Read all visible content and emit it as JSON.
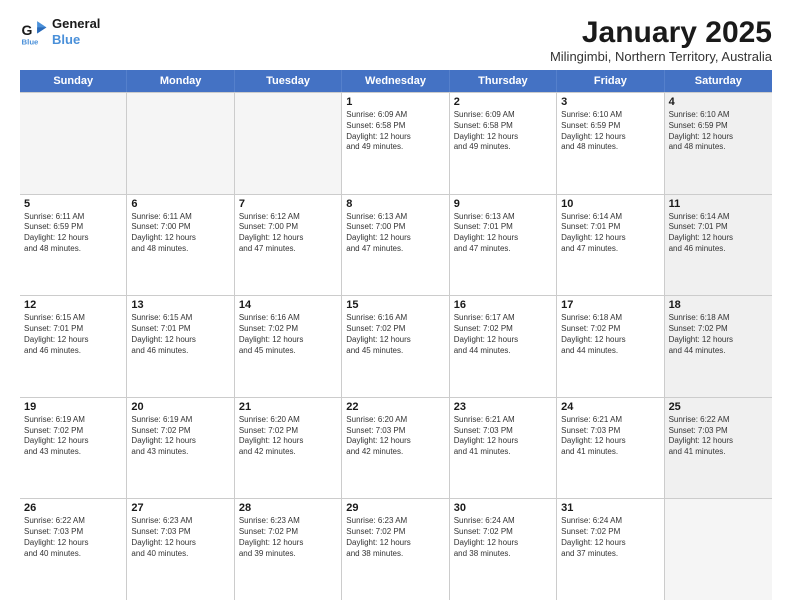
{
  "logo": {
    "line1": "General",
    "line2": "Blue"
  },
  "title": "January 2025",
  "location": "Milingimbi, Northern Territory, Australia",
  "weekdays": [
    "Sunday",
    "Monday",
    "Tuesday",
    "Wednesday",
    "Thursday",
    "Friday",
    "Saturday"
  ],
  "weeks": [
    [
      {
        "day": "",
        "text": "",
        "empty": true
      },
      {
        "day": "",
        "text": "",
        "empty": true
      },
      {
        "day": "",
        "text": "",
        "empty": true
      },
      {
        "day": "1",
        "text": "Sunrise: 6:09 AM\nSunset: 6:58 PM\nDaylight: 12 hours\nand 49 minutes."
      },
      {
        "day": "2",
        "text": "Sunrise: 6:09 AM\nSunset: 6:58 PM\nDaylight: 12 hours\nand 49 minutes."
      },
      {
        "day": "3",
        "text": "Sunrise: 6:10 AM\nSunset: 6:59 PM\nDaylight: 12 hours\nand 48 minutes."
      },
      {
        "day": "4",
        "text": "Sunrise: 6:10 AM\nSunset: 6:59 PM\nDaylight: 12 hours\nand 48 minutes.",
        "shaded": true
      }
    ],
    [
      {
        "day": "5",
        "text": "Sunrise: 6:11 AM\nSunset: 6:59 PM\nDaylight: 12 hours\nand 48 minutes."
      },
      {
        "day": "6",
        "text": "Sunrise: 6:11 AM\nSunset: 7:00 PM\nDaylight: 12 hours\nand 48 minutes."
      },
      {
        "day": "7",
        "text": "Sunrise: 6:12 AM\nSunset: 7:00 PM\nDaylight: 12 hours\nand 47 minutes."
      },
      {
        "day": "8",
        "text": "Sunrise: 6:13 AM\nSunset: 7:00 PM\nDaylight: 12 hours\nand 47 minutes."
      },
      {
        "day": "9",
        "text": "Sunrise: 6:13 AM\nSunset: 7:01 PM\nDaylight: 12 hours\nand 47 minutes."
      },
      {
        "day": "10",
        "text": "Sunrise: 6:14 AM\nSunset: 7:01 PM\nDaylight: 12 hours\nand 47 minutes."
      },
      {
        "day": "11",
        "text": "Sunrise: 6:14 AM\nSunset: 7:01 PM\nDaylight: 12 hours\nand 46 minutes.",
        "shaded": true
      }
    ],
    [
      {
        "day": "12",
        "text": "Sunrise: 6:15 AM\nSunset: 7:01 PM\nDaylight: 12 hours\nand 46 minutes."
      },
      {
        "day": "13",
        "text": "Sunrise: 6:15 AM\nSunset: 7:01 PM\nDaylight: 12 hours\nand 46 minutes."
      },
      {
        "day": "14",
        "text": "Sunrise: 6:16 AM\nSunset: 7:02 PM\nDaylight: 12 hours\nand 45 minutes."
      },
      {
        "day": "15",
        "text": "Sunrise: 6:16 AM\nSunset: 7:02 PM\nDaylight: 12 hours\nand 45 minutes."
      },
      {
        "day": "16",
        "text": "Sunrise: 6:17 AM\nSunset: 7:02 PM\nDaylight: 12 hours\nand 44 minutes."
      },
      {
        "day": "17",
        "text": "Sunrise: 6:18 AM\nSunset: 7:02 PM\nDaylight: 12 hours\nand 44 minutes."
      },
      {
        "day": "18",
        "text": "Sunrise: 6:18 AM\nSunset: 7:02 PM\nDaylight: 12 hours\nand 44 minutes.",
        "shaded": true
      }
    ],
    [
      {
        "day": "19",
        "text": "Sunrise: 6:19 AM\nSunset: 7:02 PM\nDaylight: 12 hours\nand 43 minutes."
      },
      {
        "day": "20",
        "text": "Sunrise: 6:19 AM\nSunset: 7:02 PM\nDaylight: 12 hours\nand 43 minutes."
      },
      {
        "day": "21",
        "text": "Sunrise: 6:20 AM\nSunset: 7:02 PM\nDaylight: 12 hours\nand 42 minutes."
      },
      {
        "day": "22",
        "text": "Sunrise: 6:20 AM\nSunset: 7:03 PM\nDaylight: 12 hours\nand 42 minutes."
      },
      {
        "day": "23",
        "text": "Sunrise: 6:21 AM\nSunset: 7:03 PM\nDaylight: 12 hours\nand 41 minutes."
      },
      {
        "day": "24",
        "text": "Sunrise: 6:21 AM\nSunset: 7:03 PM\nDaylight: 12 hours\nand 41 minutes."
      },
      {
        "day": "25",
        "text": "Sunrise: 6:22 AM\nSunset: 7:03 PM\nDaylight: 12 hours\nand 41 minutes.",
        "shaded": true
      }
    ],
    [
      {
        "day": "26",
        "text": "Sunrise: 6:22 AM\nSunset: 7:03 PM\nDaylight: 12 hours\nand 40 minutes."
      },
      {
        "day": "27",
        "text": "Sunrise: 6:23 AM\nSunset: 7:03 PM\nDaylight: 12 hours\nand 40 minutes."
      },
      {
        "day": "28",
        "text": "Sunrise: 6:23 AM\nSunset: 7:02 PM\nDaylight: 12 hours\nand 39 minutes."
      },
      {
        "day": "29",
        "text": "Sunrise: 6:23 AM\nSunset: 7:02 PM\nDaylight: 12 hours\nand 38 minutes."
      },
      {
        "day": "30",
        "text": "Sunrise: 6:24 AM\nSunset: 7:02 PM\nDaylight: 12 hours\nand 38 minutes."
      },
      {
        "day": "31",
        "text": "Sunrise: 6:24 AM\nSunset: 7:02 PM\nDaylight: 12 hours\nand 37 minutes."
      },
      {
        "day": "",
        "text": "",
        "empty": true,
        "shaded": true
      }
    ]
  ]
}
